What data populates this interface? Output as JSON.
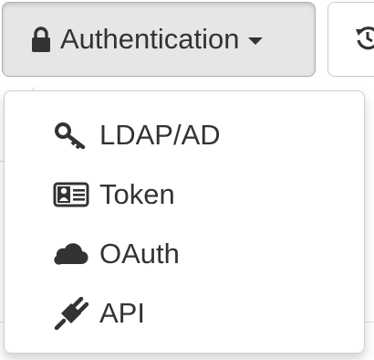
{
  "toolbar": {
    "auth_button": {
      "label": "Authentication",
      "icon": "lock-icon"
    },
    "next_button": {
      "icon": "history-icon"
    }
  },
  "menu": {
    "items": [
      {
        "label": "LDAP/AD",
        "icon": "key-icon"
      },
      {
        "label": "Token",
        "icon": "id-card-icon"
      },
      {
        "label": "OAuth",
        "icon": "cloud-icon"
      },
      {
        "label": "API",
        "icon": "plug-icon"
      }
    ]
  },
  "colors": {
    "text": "#333333",
    "button_active_bg": "#e6e6e6",
    "button_border": "#adadad",
    "menu_border": "#cfcfcf"
  }
}
